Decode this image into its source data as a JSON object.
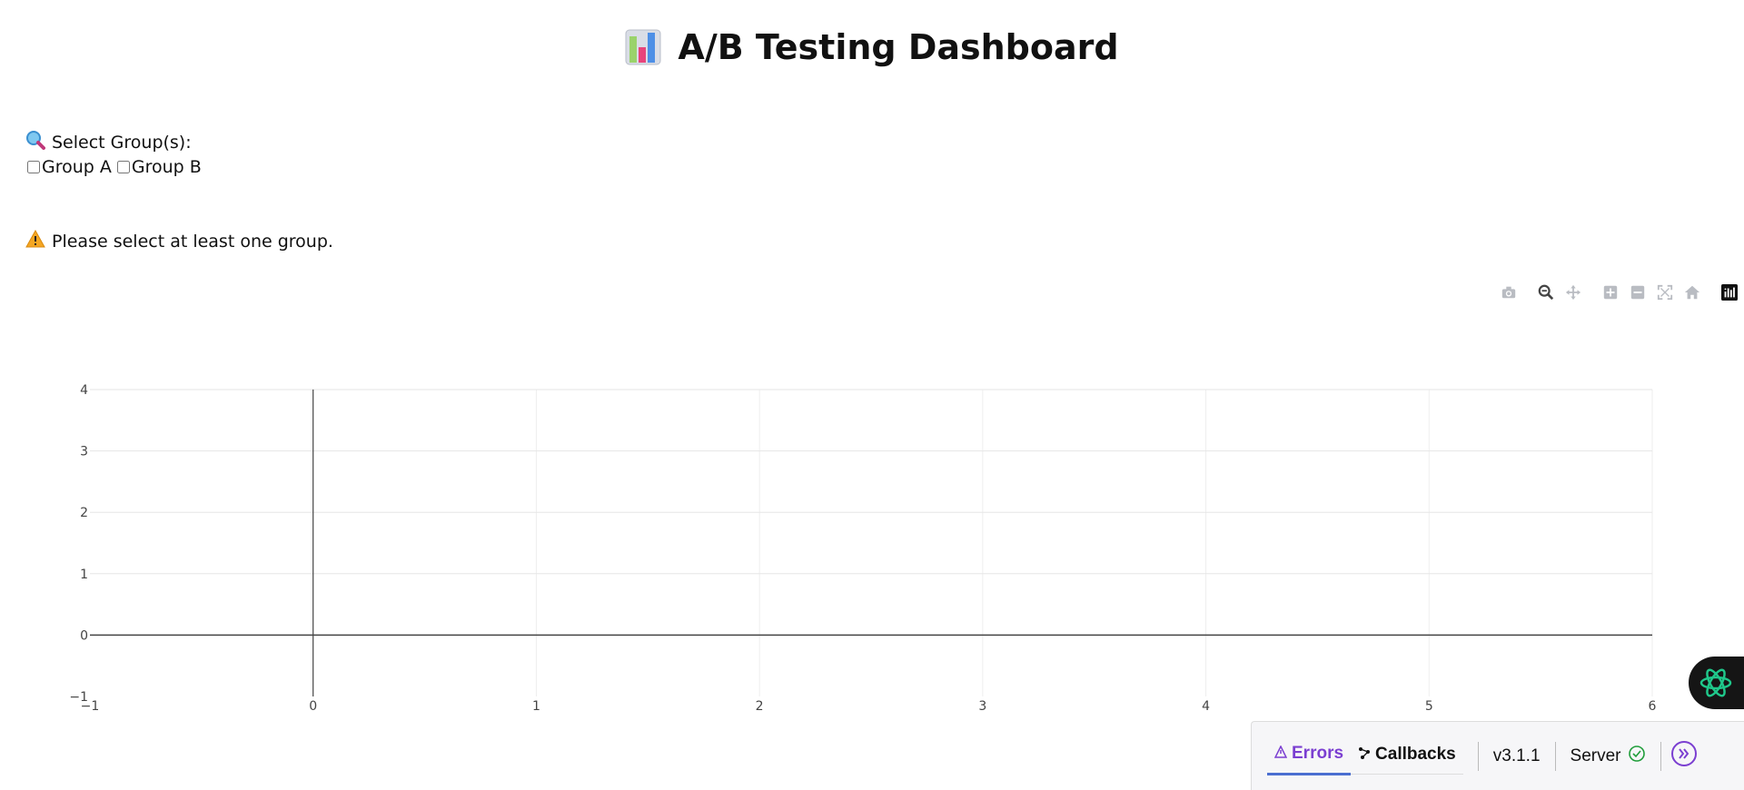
{
  "page": {
    "title": "A/B Testing Dashboard",
    "title_icon": "bar-chart-icon"
  },
  "filter": {
    "label": "Select Group(s):",
    "label_icon": "magnifier-icon",
    "options": [
      {
        "label": "Group A",
        "checked": false
      },
      {
        "label": "Group B",
        "checked": false
      }
    ]
  },
  "warning": {
    "icon": "warning-icon",
    "text": "Please select at least one group."
  },
  "modebar": {
    "buttons": [
      "camera-icon",
      "zoom-icon",
      "pan-icon",
      "zoom-in-icon",
      "zoom-out-icon",
      "autoscale-icon",
      "reset-axes-icon",
      "plotly-logo-icon"
    ]
  },
  "chart_data": {
    "type": "scatter",
    "series": [],
    "xlim": [
      -1,
      6
    ],
    "ylim": [
      -1,
      4
    ],
    "x_ticks": [
      "−1",
      "0",
      "1",
      "2",
      "3",
      "4",
      "5",
      "6"
    ],
    "y_ticks": [
      "−1",
      "0",
      "1",
      "2",
      "3",
      "4"
    ],
    "grid": true,
    "title": "",
    "xlabel": "",
    "ylabel": ""
  },
  "devtools": {
    "errors_label": "Errors",
    "callbacks_label": "Callbacks",
    "version": "v3.1.1",
    "server_label": "Server",
    "colors": {
      "accent": "#7b3fd1",
      "ok": "#1f9d3a"
    }
  }
}
